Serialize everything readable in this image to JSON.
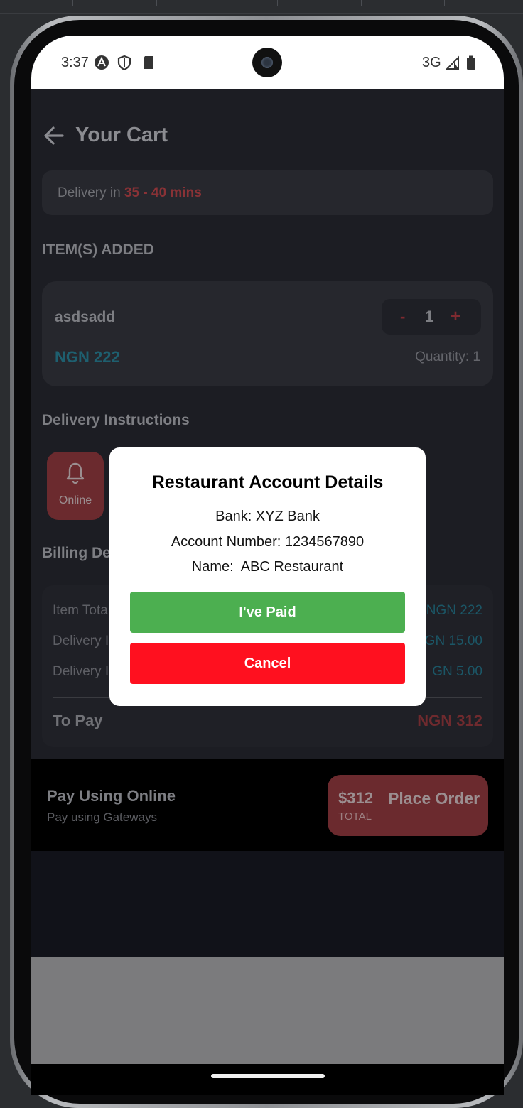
{
  "status_bar": {
    "time": "3:37",
    "network": "3G"
  },
  "header": {
    "title": "Your Cart"
  },
  "delivery": {
    "prefix": "Delivery in ",
    "time": "35 - 40 mins"
  },
  "items_section": {
    "heading": "ITEM(S) ADDED",
    "items": [
      {
        "name": "asdsadd",
        "price": "NGN 222",
        "minus": "-",
        "quantity": "1",
        "plus": "+",
        "quantity_label": "Quantity: 1"
      }
    ]
  },
  "instructions": {
    "heading": "Delivery Instructions",
    "option_label": "Online"
  },
  "billing": {
    "heading_partial": "Billing De",
    "rows": [
      {
        "label": "Item Tota",
        "value": "NGN 222"
      },
      {
        "label": "Delivery I",
        "value": "GN 15.00"
      },
      {
        "label": "Delivery I",
        "value": "GN 5.00"
      }
    ],
    "to_pay_label": "To Pay",
    "to_pay_value": "NGN 312"
  },
  "bottom_bar": {
    "pay_title": "Pay Using Online",
    "pay_subtitle": "Pay using Gateways",
    "total": "$312",
    "total_label": "TOTAL",
    "place_order": "Place Order"
  },
  "modal": {
    "title": "Restaurant Account Details",
    "bank": "Bank: XYZ Bank",
    "account_number": "Account Number: 1234567890",
    "name": "Name:  ABC Restaurant",
    "paid_button": "I've Paid",
    "cancel_button": "Cancel"
  },
  "colors": {
    "accent_red": "#ff101f",
    "paid_green": "#4caf50",
    "price_teal": "#1e5f6f"
  }
}
